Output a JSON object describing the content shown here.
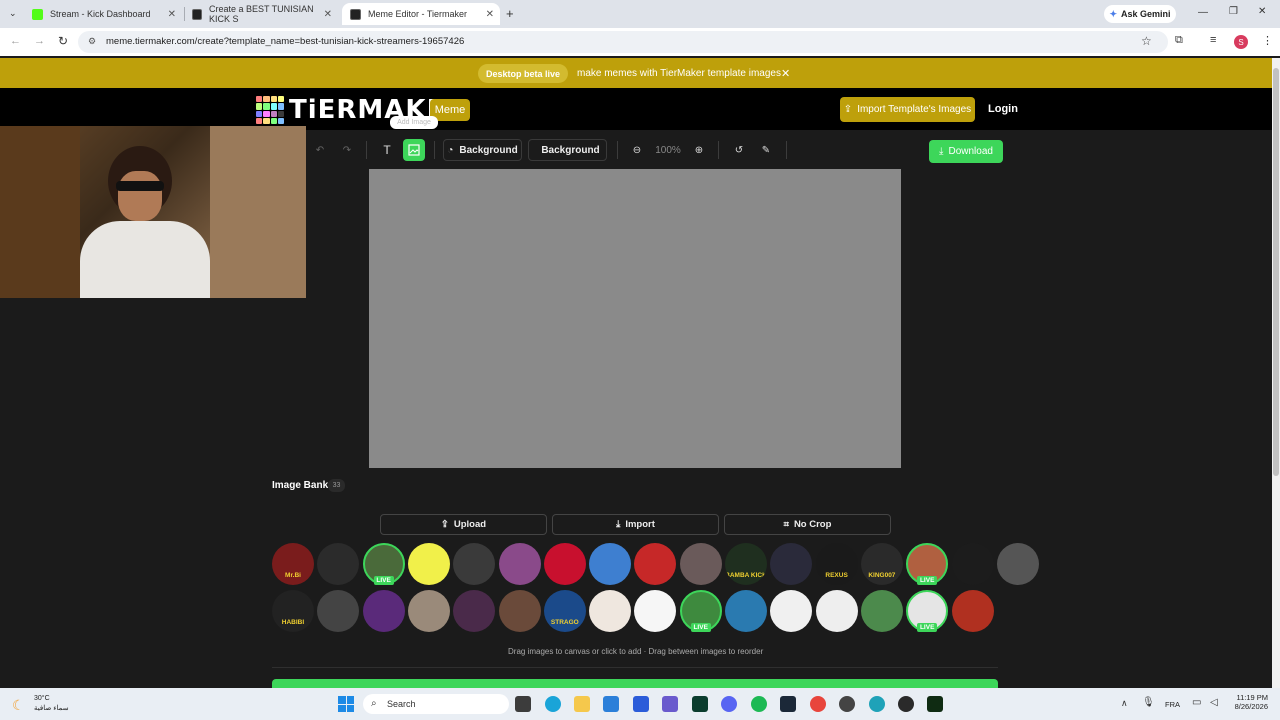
{
  "browser": {
    "tabs": [
      {
        "title": "Stream - Kick Dashboard"
      },
      {
        "title": "Create a BEST TUNISIAN KICK S"
      },
      {
        "title": "Meme Editor - Tiermaker"
      }
    ],
    "new_tab": "+",
    "ask_gemini": "Ask Gemini",
    "url": "meme.tiermaker.com/create?template_name=best-tunisian-kick-streamers-19657426",
    "profile_initial": "S"
  },
  "banner": {
    "pill": "Desktop beta live",
    "text": "make memes with TierMaker template images",
    "close": "✕"
  },
  "header": {
    "logo": "TiERMAKER",
    "badge": "Meme",
    "import_label": "Import Template's Images",
    "login": "Login"
  },
  "toolbar": {
    "add_image_tooltip": "Add Image",
    "bg_label_1": "Background",
    "bg_label_2": "Background",
    "zoom": "100%",
    "download": "Download"
  },
  "bank": {
    "title": "Image Bank",
    "count": "33",
    "upload": "Upload",
    "import": "Import",
    "no_crop": "No Crop",
    "live_label": "LIVE",
    "hint": "Drag images to canvas or click to add · Drag between images to reorder",
    "row1_labels": [
      "Mr.Bi",
      "",
      "",
      "",
      "",
      "",
      "",
      "",
      "",
      "",
      "BAMBA KICK",
      "",
      "REXUS",
      "KING007",
      "",
      "",
      ""
    ],
    "row2_labels": [
      "HABIBI",
      "",
      "",
      "",
      "",
      "",
      "STRAGO",
      "",
      "",
      "",
      "",
      "",
      "",
      "",
      "",
      ""
    ]
  },
  "colors": {
    "accent": "#bea00b",
    "green": "#3dd65a",
    "canvas": "#8a8a8a"
  },
  "taskbar": {
    "temp": "30°C",
    "weather": "سماء صافية",
    "search": "Search",
    "lang": "FRA",
    "time": "11:19 PM",
    "date": "8/26/2026"
  }
}
